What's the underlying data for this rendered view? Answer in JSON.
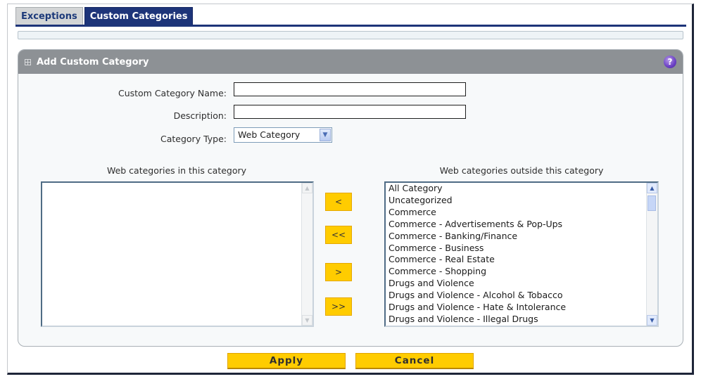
{
  "tabs": [
    {
      "label": "Exceptions",
      "active": false
    },
    {
      "label": "Custom Categories",
      "active": true
    }
  ],
  "panel": {
    "title": "Add Custom Category",
    "help_glyph": "?"
  },
  "form": {
    "name_label": "Custom Category Name:",
    "name_value": "",
    "description_label": "Description:",
    "description_value": "",
    "type_label": "Category Type:",
    "type_selected": "Web Category"
  },
  "lists": {
    "inside_heading": "Web categories in this category",
    "outside_heading": "Web categories outside this category",
    "inside_items": [],
    "outside_items": [
      "All Category",
      "Uncategorized",
      "Commerce",
      "Commerce - Advertisements & Pop-Ups",
      "Commerce - Banking/Finance",
      "Commerce - Business",
      "Commerce - Real Estate",
      "Commerce - Shopping",
      "Drugs and Violence",
      "Drugs and Violence - Alcohol & Tobacco",
      "Drugs and Violence - Hate & Intolerance",
      "Drugs and Violence - Illegal Drugs"
    ]
  },
  "move_buttons": {
    "add_one": "<",
    "add_all": "<<",
    "remove_one": ">",
    "remove_all": ">>"
  },
  "actions": {
    "apply": "Apply",
    "cancel": "Cancel"
  },
  "colors": {
    "tab_active": "#1d3479",
    "header_bar": "#8d9195",
    "button": "#ffcc00"
  }
}
